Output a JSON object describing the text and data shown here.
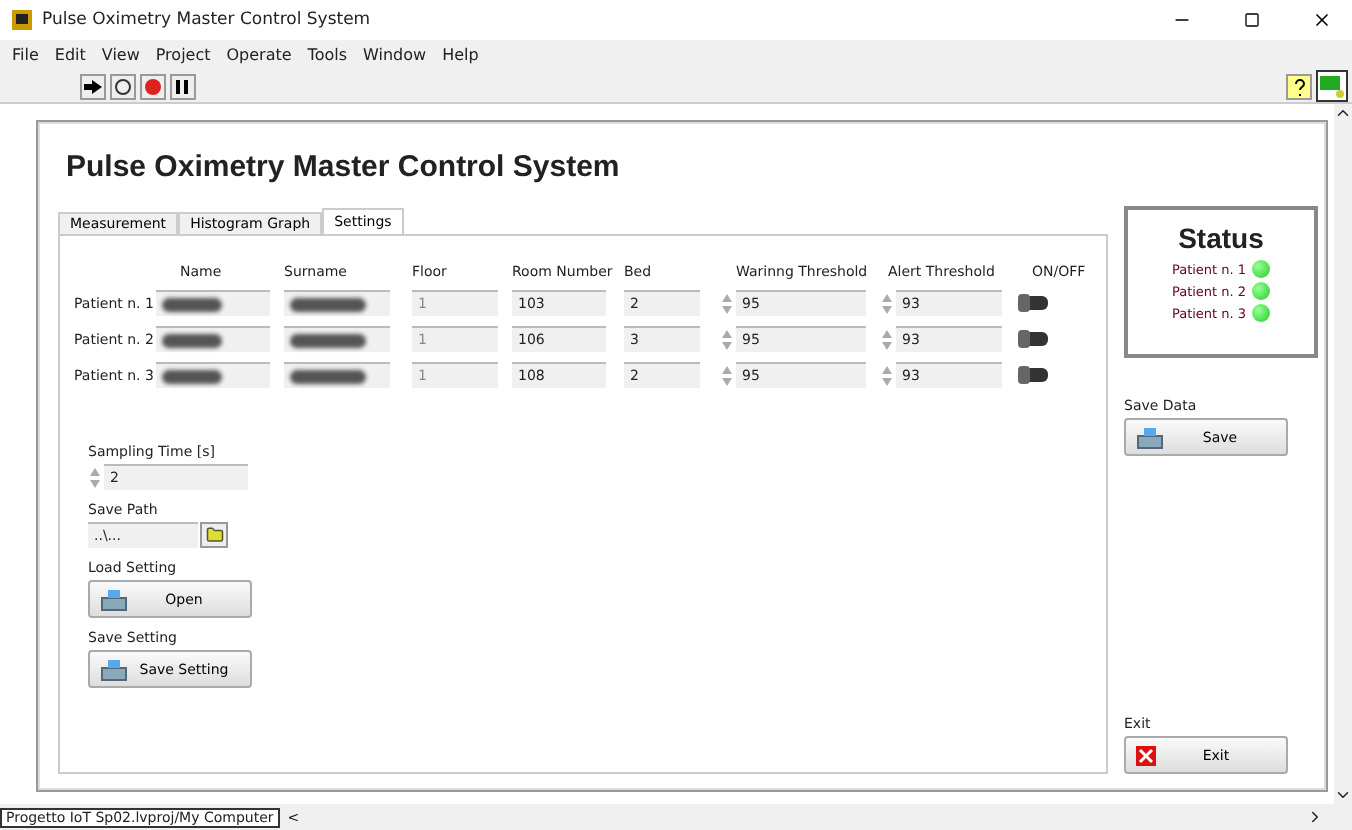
{
  "window": {
    "title": "Pulse Oximetry Master Control System"
  },
  "menu": [
    "File",
    "Edit",
    "View",
    "Project",
    "Operate",
    "Tools",
    "Window",
    "Help"
  ],
  "panel_title": "Pulse Oximetry Master Control System",
  "tabs": [
    {
      "label": "Measurement",
      "selected": false
    },
    {
      "label": "Histogram Graph",
      "selected": false
    },
    {
      "label": "Settings",
      "selected": true
    }
  ],
  "columns": [
    "Name",
    "Surname",
    "Floor",
    "Room Number",
    "Bed",
    "Warinng Threshold",
    "Alert Threshold",
    "ON/OFF"
  ],
  "patients": [
    {
      "label": "Patient n. 1",
      "floor": "1",
      "room": "103",
      "bed": "2",
      "warning": "95",
      "alert": "93",
      "on": false
    },
    {
      "label": "Patient n. 2",
      "floor": "1",
      "room": "106",
      "bed": "3",
      "warning": "95",
      "alert": "93",
      "on": false
    },
    {
      "label": "Patient n. 3",
      "floor": "1",
      "room": "108",
      "bed": "2",
      "warning": "95",
      "alert": "93",
      "on": false
    }
  ],
  "sampling": {
    "label": "Sampling Time [s]",
    "value": "2"
  },
  "save_path": {
    "label": "Save Path",
    "value": "..\\..."
  },
  "load_setting": {
    "label": "Load Setting",
    "button": "Open"
  },
  "save_setting": {
    "label": "Save Setting",
    "button": "Save Setting"
  },
  "status": {
    "title": "Status",
    "items": [
      {
        "label": "Patient n. 1",
        "on": true
      },
      {
        "label": "Patient n. 2",
        "on": true
      },
      {
        "label": "Patient n. 3",
        "on": true
      }
    ]
  },
  "save_data": {
    "label": "Save Data",
    "button": "Save"
  },
  "exit": {
    "label": "Exit",
    "button": "Exit"
  },
  "status_bar": {
    "path": "Progetto IoT Sp02.lvproj/My Computer",
    "scroll": "<"
  }
}
